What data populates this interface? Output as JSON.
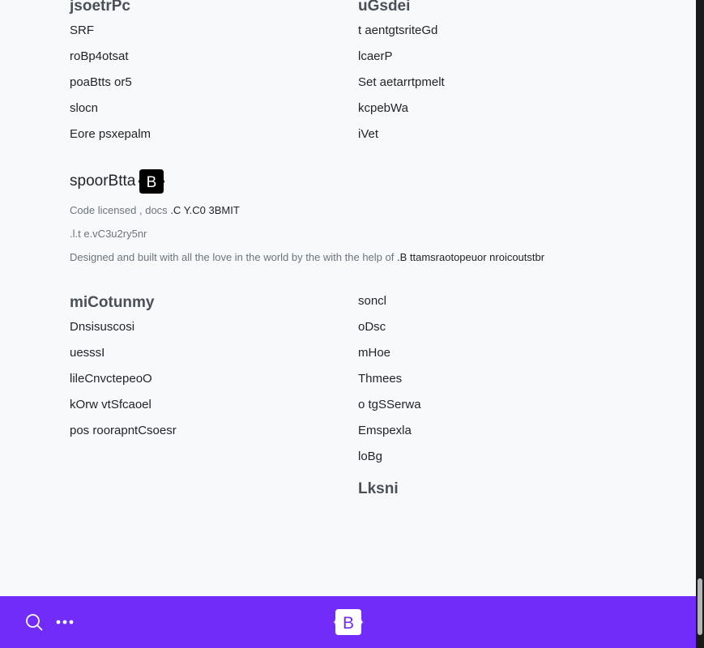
{
  "top_sections": {
    "left": {
      "heading": "jsoetrPc",
      "links": [
        "SRF",
        "roBp4otsat",
        "poaBtts or5",
        "slocn",
        "Eore psxepalm"
      ]
    },
    "right": {
      "heading": "uGsdei",
      "links": [
        "t aentgtsriteGd",
        "lcaerP",
        "Set aetarrtpmelt",
        "kcpebWa",
        "iVet"
      ]
    }
  },
  "brand": {
    "name": "spoorBtta",
    "logo_letter": "B",
    "license_text": "Code licensed , docs",
    "license_value": ".C Y.C0 3BMIT",
    "version_text": ".l.t e.vC3u2ry5nr",
    "credit_text": "Designed and built with all the love in the world by the with the help of",
    "credit_value": ".B ttamsraotopeuor nroicoutstbr"
  },
  "bottom_sections": {
    "left": {
      "heading": "miCotunmy",
      "links": [
        "Dnsisuscosi",
        "uesssI",
        "lileCnvctepeoO",
        "kOrw vtSfcaoel",
        "pos roorapntCsoesr"
      ]
    },
    "right": {
      "links": [
        "soncl",
        "oDsc",
        "mHoe",
        "Thmees",
        "o tgSSerwa",
        "Emspexla",
        "loBg"
      ],
      "heading": "Lksni"
    }
  },
  "bottombar": {
    "logo_letter": "B",
    "search_icon": "search-icon",
    "more_icon": "more-horizontal-icon",
    "background": "#712cf9"
  },
  "colors": {
    "accent": "#712cf9",
    "background": "#f8f9fa",
    "heading": "#495057",
    "muted": "#6c757d"
  }
}
